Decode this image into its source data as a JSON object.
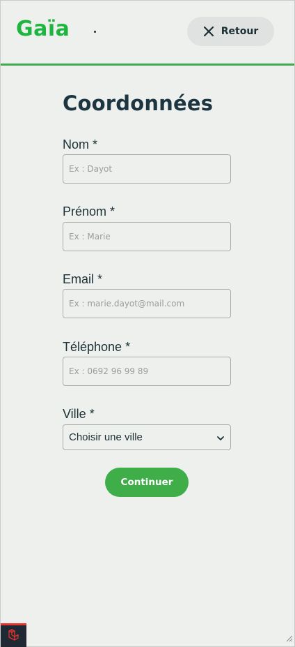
{
  "header": {
    "logo_text": "Gaïa",
    "back_label": "Retour"
  },
  "form": {
    "title": "Coordonnées",
    "fields": [
      {
        "label": "Nom *",
        "placeholder": "Ex : Dayot"
      },
      {
        "label": "Prénom *",
        "placeholder": "Ex : Marie"
      },
      {
        "label": "Email *",
        "placeholder": "Ex : marie.dayot@mail.com"
      },
      {
        "label": "Téléphone *",
        "placeholder": "Ex : 0692 96 99 89"
      }
    ],
    "city": {
      "label": "Ville *",
      "selected": "Choisir une ville"
    },
    "submit_label": "Continuer"
  },
  "colors": {
    "brand_green": "#1db53f",
    "button_green": "#3fae49",
    "header_rule": "#3fa94c",
    "background": "#eef0ee",
    "text_dark": "#1b2f35"
  },
  "icons": {
    "close": "close-icon",
    "chevron": "chevron-down-icon",
    "laravel": "laravel-logo-icon",
    "resize": "resize-grip-icon"
  }
}
